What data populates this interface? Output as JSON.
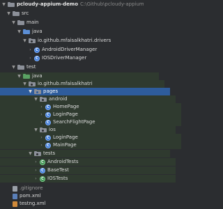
{
  "project": {
    "name": "pcloudy-appium-demo",
    "path": "C:\\Github\\pcloudy-appium-de"
  },
  "tree": {
    "src": "src",
    "main": "main",
    "main_java": "java",
    "drivers_pkg": "io.github.mfaisalkhatri.drivers",
    "android_driver": "AndroidDriverManager",
    "ios_driver": "IOSDriverManager",
    "test": "test",
    "test_java": "java",
    "test_pkg": "io.github.mfaisalkhatri",
    "pages": "pages",
    "android": "android",
    "home_page": "HomePage",
    "login_page_android": "LoginPage",
    "search_flight_page": "SearchFlightPage",
    "ios": "ios",
    "login_page_ios": "LoginPage",
    "main_page": "MainPage",
    "tests": "tests",
    "android_tests": "AndroidTests",
    "base_test": "BaseTest",
    "ios_tests": "IOSTests",
    "gitignore": ".gitignore",
    "pom": "pom.xml",
    "testng": "testng.xml"
  },
  "colors": {
    "selected": "#2e5c9c",
    "test_highlight": "#2f3a2f",
    "background": "#2b2d30"
  }
}
